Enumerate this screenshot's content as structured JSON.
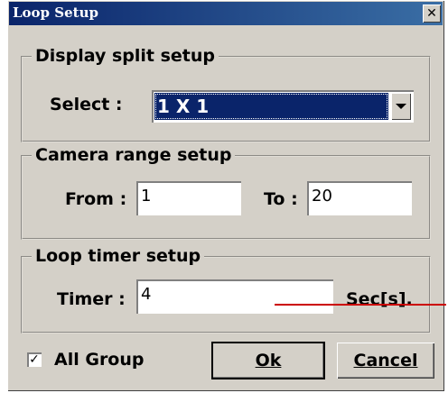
{
  "window": {
    "title": "Loop Setup",
    "close_glyph": "✕"
  },
  "display_split": {
    "legend": "Display split setup",
    "select_label": "Select :",
    "selected_value": "1 X 1"
  },
  "camera_range": {
    "legend": "Camera range setup",
    "from_label": "From :",
    "from_value": "1",
    "to_label": "To :",
    "to_value": "20"
  },
  "loop_timer": {
    "legend": "Loop timer setup",
    "timer_label": "Timer :",
    "timer_value": "4",
    "unit": "Sec[s]."
  },
  "footer": {
    "all_group_checked": true,
    "all_group_check_glyph": "✓",
    "all_group_label": "All Group",
    "ok_label": "Ok",
    "cancel_label": "Cancel"
  },
  "colors": {
    "titlebar": "#0a246a",
    "dialog_bg": "#d4d0c8",
    "selection": "#0a246a",
    "annotation": "#cc0000"
  },
  "icons": [
    "close-icon",
    "chevron-down-icon",
    "checkmark-icon"
  ]
}
